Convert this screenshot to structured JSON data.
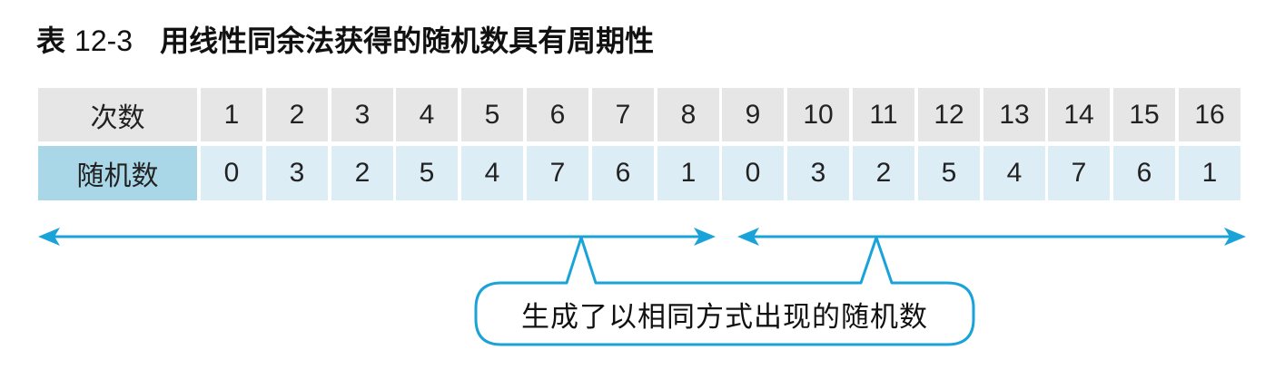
{
  "title": {
    "prefix": "表",
    "number": "12-3",
    "text": "用线性同余法获得的随机数具有周期性"
  },
  "table": {
    "row_labels": {
      "count": "次数",
      "random": "随机数"
    },
    "counts": [
      "1",
      "2",
      "3",
      "4",
      "5",
      "6",
      "7",
      "8",
      "9",
      "10",
      "11",
      "12",
      "13",
      "14",
      "15",
      "16"
    ],
    "values": [
      "0",
      "3",
      "2",
      "5",
      "4",
      "7",
      "6",
      "1",
      "0",
      "3",
      "2",
      "5",
      "4",
      "7",
      "6",
      "1"
    ]
  },
  "callout": {
    "text": "生成了以相同方式出现的随机数"
  },
  "colors": {
    "header_bg": "#e6e6e6",
    "value_bg": "#dcedf6",
    "label_value_bg": "#a9d7e8",
    "accent": "#1aa3d8"
  }
}
